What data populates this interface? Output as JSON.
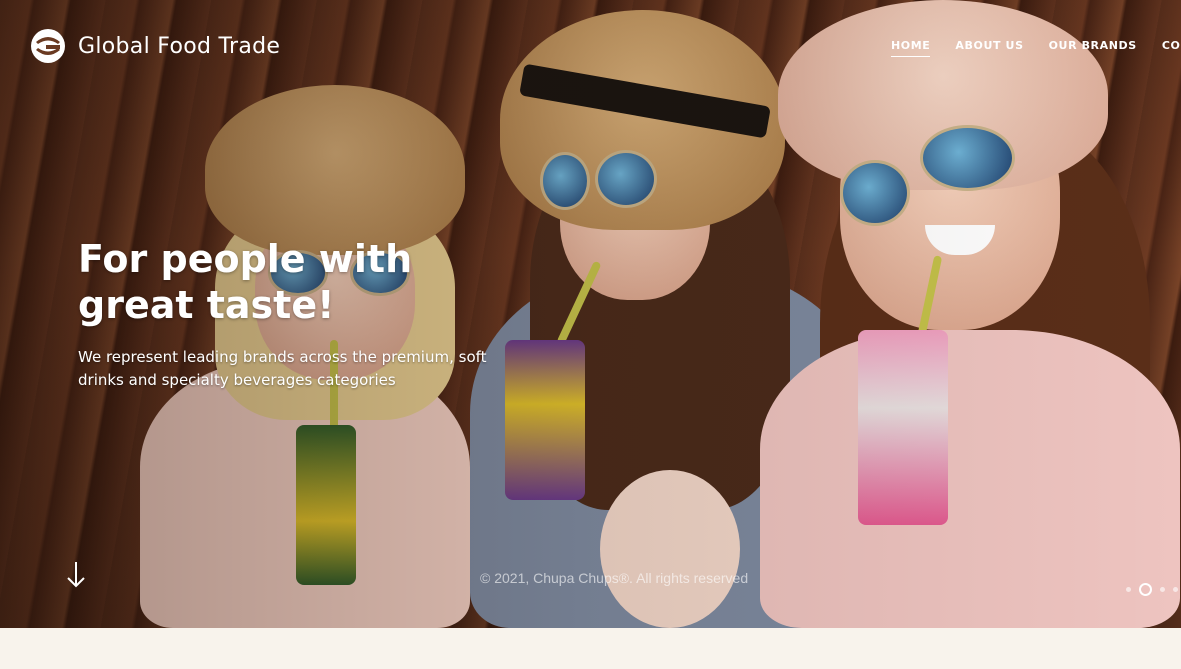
{
  "brand": {
    "name": "Global Food Trade",
    "logo_icon": "g-logo-icon"
  },
  "nav": {
    "items": [
      {
        "label": "HOME",
        "active": true
      },
      {
        "label": "ABOUT US",
        "active": false
      },
      {
        "label": "OUR BRANDS",
        "active": false
      },
      {
        "label": "CONTACT",
        "active": false
      }
    ]
  },
  "hero": {
    "headline": "For people with great taste!",
    "subline": "We represent leading brands across the premium, soft drinks and specialty beverages categories",
    "image_text": "© 2021, Chupa Chups®. All rights reserved",
    "scroll_icon": "arrow-down-icon",
    "slider": {
      "count": 4,
      "active_index": 1
    }
  },
  "colors": {
    "text": "#ffffff",
    "page_bg": "#f8f3ec"
  }
}
